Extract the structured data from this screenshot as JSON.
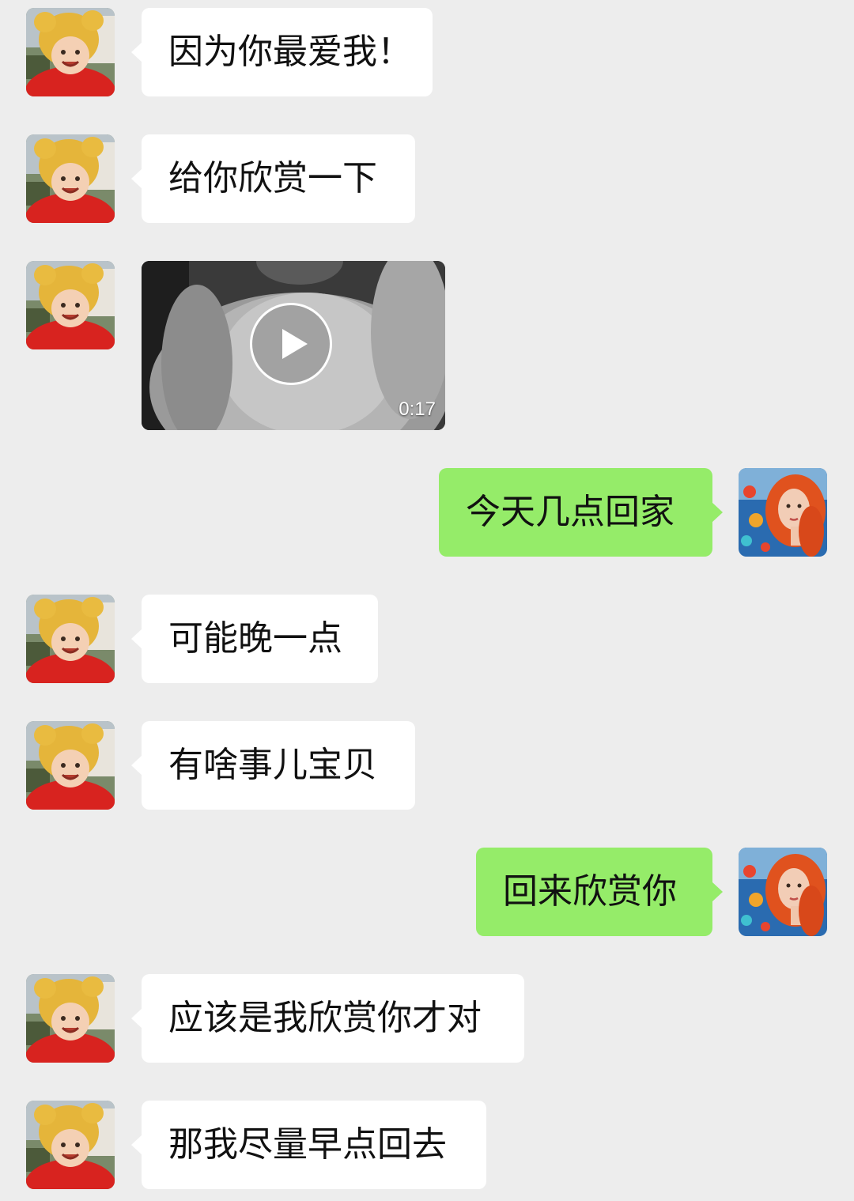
{
  "chat": {
    "messages": [
      {
        "sender": "contact",
        "type": "text",
        "text": "因为你最爱我！"
      },
      {
        "sender": "contact",
        "type": "text",
        "text": "给你欣赏一下"
      },
      {
        "sender": "contact",
        "type": "video",
        "duration": "0:17"
      },
      {
        "sender": "me",
        "type": "text",
        "text": "今天几点回家"
      },
      {
        "sender": "contact",
        "type": "text",
        "text": "可能晚一点"
      },
      {
        "sender": "contact",
        "type": "text",
        "text": "有啥事儿宝贝"
      },
      {
        "sender": "me",
        "type": "text",
        "text": "回来欣赏你"
      },
      {
        "sender": "contact",
        "type": "text",
        "text": "应该是我欣赏你才对"
      },
      {
        "sender": "contact",
        "type": "text",
        "text": "那我尽量早点回去"
      }
    ]
  },
  "colors": {
    "background": "#ededed",
    "incoming_bubble": "#ffffff",
    "outgoing_bubble": "#95ec69"
  },
  "icons": {
    "play": "play-icon",
    "contact_avatar": "child-in-yellow-bear-hat",
    "my_avatar": "red-haired-girl-with-fish"
  }
}
